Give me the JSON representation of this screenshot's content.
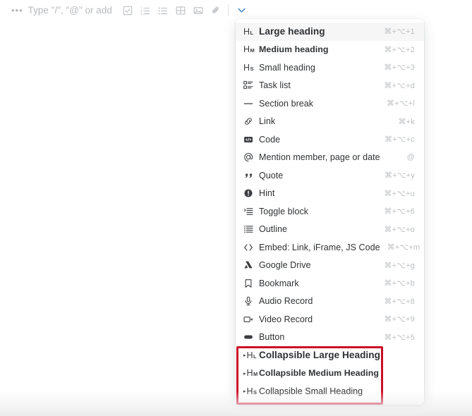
{
  "editor": {
    "drag_handle": "•••",
    "placeholder": "Type \"/\", \"@\" or add",
    "toolbar_icons": [
      {
        "name": "task-list-icon",
        "glyph": "checkbox"
      },
      {
        "name": "numbered-list-icon",
        "glyph": "ordered-list"
      },
      {
        "name": "bullet-list-icon",
        "glyph": "unordered-list"
      },
      {
        "name": "table-icon",
        "glyph": "table"
      },
      {
        "name": "image-icon",
        "glyph": "image"
      },
      {
        "name": "attachment-icon",
        "glyph": "paperclip"
      }
    ],
    "expand_icon": "chevron-down-icon",
    "accent_color": "#4a8fd4"
  },
  "menu": {
    "highlight_color": "#cc0f28",
    "items": [
      {
        "label": "Large heading",
        "shortcut": "⌘+⌥+1",
        "icon": "heading-large-icon",
        "icon_letter": "H",
        "icon_sub": "L",
        "weight": "w-bold",
        "active": true,
        "collapsible": false,
        "highlighted": false
      },
      {
        "label": "Medium heading",
        "shortcut": "⌘+⌥+2",
        "icon": "heading-medium-icon",
        "icon_letter": "H",
        "icon_sub": "M",
        "weight": "w-semi",
        "active": false,
        "collapsible": false,
        "highlighted": false
      },
      {
        "label": "Small heading",
        "shortcut": "⌘+⌥+3",
        "icon": "heading-small-icon",
        "icon_letter": "H",
        "icon_sub": "S",
        "weight": "w-normal",
        "active": false,
        "collapsible": false,
        "highlighted": false
      },
      {
        "label": "Task list",
        "shortcut": "⌘+⌥+d",
        "icon": "task-list-icon",
        "icon_letter": "",
        "icon_sub": "",
        "weight": "w-normal",
        "active": false,
        "collapsible": false,
        "highlighted": false
      },
      {
        "label": "Section break",
        "shortcut": "⌘+⌥+l",
        "icon": "section-break-icon",
        "icon_letter": "",
        "icon_sub": "",
        "weight": "w-normal",
        "active": false,
        "collapsible": false,
        "highlighted": false
      },
      {
        "label": "Link",
        "shortcut": "⌘+k",
        "icon": "link-icon",
        "icon_letter": "",
        "icon_sub": "",
        "weight": "w-normal",
        "active": false,
        "collapsible": false,
        "highlighted": false
      },
      {
        "label": "Code",
        "shortcut": "⌘+⌥+c",
        "icon": "code-icon",
        "icon_letter": "",
        "icon_sub": "",
        "weight": "w-normal",
        "active": false,
        "collapsible": false,
        "highlighted": false
      },
      {
        "label": "Mention member, page or date",
        "shortcut": "@",
        "icon": "mention-at-icon",
        "icon_letter": "",
        "icon_sub": "",
        "weight": "w-normal",
        "active": false,
        "collapsible": false,
        "highlighted": false
      },
      {
        "label": "Quote",
        "shortcut": "⌘+⌥+y",
        "icon": "quote-icon",
        "icon_letter": "",
        "icon_sub": "",
        "weight": "w-normal",
        "active": false,
        "collapsible": false,
        "highlighted": false
      },
      {
        "label": "Hint",
        "shortcut": "⌘+⌥+u",
        "icon": "hint-icon",
        "icon_letter": "",
        "icon_sub": "",
        "weight": "w-normal",
        "active": false,
        "collapsible": false,
        "highlighted": false
      },
      {
        "label": "Toggle block",
        "shortcut": "⌘+⌥+6",
        "icon": "toggle-block-icon",
        "icon_letter": "",
        "icon_sub": "",
        "weight": "w-normal",
        "active": false,
        "collapsible": false,
        "highlighted": false
      },
      {
        "label": "Outline",
        "shortcut": "⌘+⌥+o",
        "icon": "outline-icon",
        "icon_letter": "",
        "icon_sub": "",
        "weight": "w-normal",
        "active": false,
        "collapsible": false,
        "highlighted": false
      },
      {
        "label": "Embed: Link, iFrame, JS Code",
        "shortcut": "⌘+⌥+m",
        "icon": "embed-code-icon",
        "icon_letter": "",
        "icon_sub": "",
        "weight": "w-normal",
        "active": false,
        "collapsible": false,
        "highlighted": false
      },
      {
        "label": "Google Drive",
        "shortcut": "⌘+⌥+g",
        "icon": "google-drive-icon",
        "icon_letter": "",
        "icon_sub": "",
        "weight": "w-normal",
        "active": false,
        "collapsible": false,
        "highlighted": false
      },
      {
        "label": "Bookmark",
        "shortcut": "⌘+⌥+b",
        "icon": "bookmark-icon",
        "icon_letter": "",
        "icon_sub": "",
        "weight": "w-normal",
        "active": false,
        "collapsible": false,
        "highlighted": false
      },
      {
        "label": "Audio Record",
        "shortcut": "⌘+⌥+8",
        "icon": "microphone-icon",
        "icon_letter": "",
        "icon_sub": "",
        "weight": "w-normal",
        "active": false,
        "collapsible": false,
        "highlighted": false
      },
      {
        "label": "Video Record",
        "shortcut": "⌘+⌥+9",
        "icon": "video-camera-icon",
        "icon_letter": "",
        "icon_sub": "",
        "weight": "w-normal",
        "active": false,
        "collapsible": false,
        "highlighted": false
      },
      {
        "label": "Button",
        "shortcut": "⌘+⌥+5",
        "icon": "button-icon",
        "icon_letter": "",
        "icon_sub": "",
        "weight": "w-normal",
        "active": false,
        "collapsible": false,
        "highlighted": false
      },
      {
        "label": "Collapsible Large Heading",
        "shortcut": "",
        "icon": "collapsible-heading-large-icon",
        "icon_letter": "H",
        "icon_sub": "L",
        "weight": "w-bold",
        "active": false,
        "collapsible": true,
        "highlighted": true
      },
      {
        "label": "Collapsible Medium Heading",
        "shortcut": "",
        "icon": "collapsible-heading-medium-icon",
        "icon_letter": "H",
        "icon_sub": "M",
        "weight": "w-semi",
        "active": false,
        "collapsible": true,
        "highlighted": true
      },
      {
        "label": "Collapsible Small Heading",
        "shortcut": "",
        "icon": "collapsible-heading-small-icon",
        "icon_letter": "H",
        "icon_sub": "S",
        "weight": "w-normal",
        "active": false,
        "collapsible": true,
        "highlighted": true
      }
    ]
  }
}
